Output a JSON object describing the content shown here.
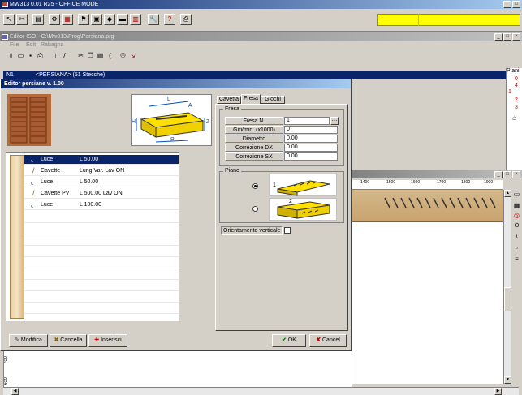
{
  "app": {
    "title": "MW313 0.01 R25 - OFFICE MODE"
  },
  "main_toolbar": {
    "icons": [
      "pointer-icon",
      "cut-icon",
      "print-icon",
      "tools-icon",
      "doc-icon",
      "settings-icon",
      "copy-icon",
      "diamond-icon",
      "save-icon",
      "chart-icon",
      "wrench-icon",
      "help-icon",
      "printer-icon"
    ],
    "glyphs": [
      "↖",
      "✂",
      "▤",
      "⚙",
      "▦",
      "⚑",
      "▣",
      "◆",
      "▬",
      "▥",
      "🔧",
      "?",
      "⎙"
    ],
    "yellow": "#ffff00"
  },
  "editor_window": {
    "title": "Editor ISO - C:\\Mw313\\Prog\\Persiana.prg",
    "menu": [
      "File",
      "Edit",
      "Rabagna"
    ],
    "line_number": "N1",
    "line_text": "<PERSIANA> (51 Stecche)"
  },
  "right_panel": {
    "title": "Piani",
    "numbers": [
      "0",
      "4",
      "1",
      "2",
      "3"
    ]
  },
  "ruler": {
    "labels": [
      "1400",
      "1500",
      "1600",
      "1700",
      "1800",
      "1900"
    ]
  },
  "dialog": {
    "title": "Editor persiane v. 1.00",
    "list": [
      {
        "type": "Luce",
        "params": "L  50.00"
      },
      {
        "type": "Cavette",
        "params": "Lung.Var.    Lav ON"
      },
      {
        "type": "Luce",
        "params": "L  50.00"
      },
      {
        "type": "Cavette PV",
        "params": "L  500.00   Lav ON"
      },
      {
        "type": "Luce",
        "params": "L  100.00"
      }
    ],
    "tabs": [
      "Cavetta",
      "Fresa",
      "Giochi"
    ],
    "active_tab": "Fresa",
    "fresa_group": "Fresa",
    "fields": [
      {
        "label": "Fresa N.",
        "value": "1"
      },
      {
        "label": "Giri/min. (x1000)",
        "value": "0"
      },
      {
        "label": "Diametro",
        "value": "0.00"
      },
      {
        "label": "Correzione DX",
        "value": "0.00"
      },
      {
        "label": "Correzione SX",
        "value": "0.00"
      }
    ],
    "piano_group": "Piano",
    "orientamento_label": "Orientamento verticale",
    "buttons": {
      "modifica": "Modifica",
      "cancella": "Cancella",
      "inserisci": "Inserisci",
      "ok": "OK",
      "cancel": "Cancel"
    },
    "diagram_labels": {
      "L": "L",
      "A": "A",
      "H": "H",
      "Z": "Z",
      "P": "P"
    },
    "piano_labels": {
      "one": "1",
      "two": "2"
    }
  },
  "bottom_ruler": {
    "labels": [
      "700",
      "600"
    ]
  }
}
